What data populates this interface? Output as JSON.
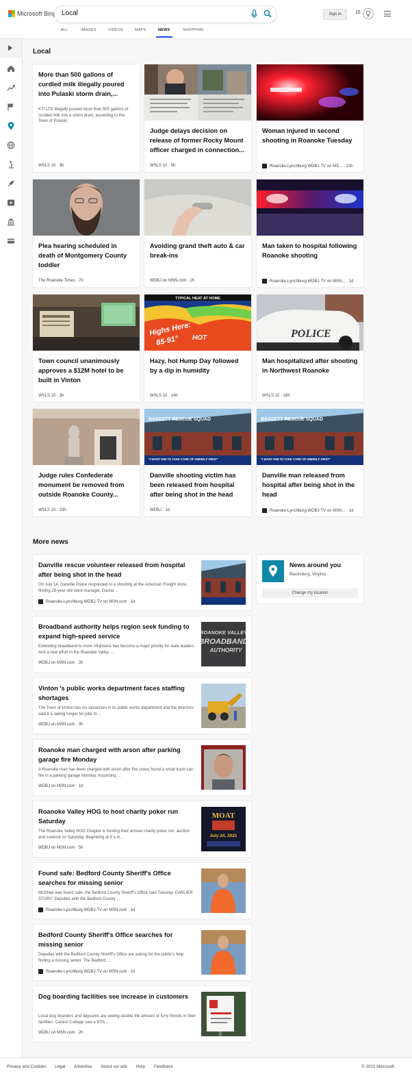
{
  "brand": {
    "name": "Microsoft Bing"
  },
  "search": {
    "query": "Local"
  },
  "header": {
    "sign_in": "Sign in",
    "points": "15"
  },
  "scopes": [
    "ALL",
    "IMAGES",
    "VIDEOS",
    "MAPS",
    "NEWS",
    "SHOPPING"
  ],
  "active_scope": "NEWS",
  "local": {
    "heading": "Local",
    "cards": [
      {
        "title": "More than 500 gallons of curdled milk illegally poured into Pulaski storm drain,...",
        "snippet": "KTI LTD illegally poured more than 500 gallons of curdled milk into a storm drain, according to the Town of Pulaski.",
        "source": "WSLS 10",
        "time": "3h",
        "image": "none"
      },
      {
        "title": "Judge delays decision on release of former Rocky Mount officer charged in connection...",
        "source": "WSLS 10",
        "time": "5h",
        "image": "collage"
      },
      {
        "title": "Woman injured in second shooting in Roanoke Tuesday",
        "source": "Roanoke-Lynchburg WDBJ-TV on MS...",
        "time": "12h",
        "image": "police-lights"
      },
      {
        "title": "Plea hearing scheduled in death of Montgomery County toddler",
        "source": "The Roanoke Times",
        "time": "7h",
        "image": "mugshot"
      },
      {
        "title": "Avoiding grand theft auto & car break-ins",
        "source": "WDBJ on MSN.com",
        "time": "2h",
        "image": "car-door"
      },
      {
        "title": "Man taken to hospital following Roanoke shooting",
        "source": "Roanoke-Lynchburg WDBJ-TV on MSN...",
        "time": "1d",
        "image": "police-lights-2"
      },
      {
        "title": "Town council unanimously approves a $12M hotel to be built in Vinton",
        "source": "WSLS 10",
        "time": "3h",
        "image": "council"
      },
      {
        "title": "Hazy, hot Hump Day followed by a dip in humidity",
        "source": "WSLS 10",
        "time": "14h",
        "image": "weather-map"
      },
      {
        "title": "Man hospitalized after shooting in Northwest Roanoke",
        "source": "WSLS 10",
        "time": "19h",
        "image": "police-car"
      },
      {
        "title": "Judge rules Confederate monument be removed from outside Roanoke County...",
        "source": "WSLS 10",
        "time": "23h",
        "image": "monument"
      },
      {
        "title": "Danville shooting victim has been released from hospital after being shot in the head",
        "source": "WDBJ",
        "time": "1d",
        "image": "rescue-squad"
      },
      {
        "title": "Danville man released from hospital after being shot in the head",
        "source": "Roanoke-Lynchburg WDBJ-TV on MSN...",
        "time": "1d",
        "image": "rescue-squad"
      }
    ]
  },
  "weather_map": {
    "banner": "TYPICAL HEAT AT HOME",
    "line1": "Highs Here:",
    "line2": "85-91°",
    "hot": "HOT"
  },
  "police_car_text": "POLICE",
  "rescue_text": "BASSETT RESCUE SQUAD",
  "chyron": "\"I WANT HIM TO TAKE CARE OF HIMSELF FIRST\"",
  "broadband_logo": [
    "ROANOKE VALLEY",
    "BROADBAND",
    "AUTHORITY"
  ],
  "poker_flyer": [
    "MOAT",
    "July 24, 2021"
  ],
  "more_news": {
    "heading": "More news",
    "items": [
      {
        "title": "Danville rescue volunteer released from hospital after being shot in the head",
        "snippet": "On July 14, Danville Police responded to a shooting at the American Freight store, finding 29-year-old store manager, Dacha ...",
        "source": "Roanoke-Lynchburg WDBJ-TV on MSN.com",
        "time": "1d",
        "logo": true,
        "thumb": "rescue-squad"
      },
      {
        "title": "Broadband authority helps region seek funding to expand high-speed service",
        "snippet": "Extending broadband to more Virginians has become a major priority for state leaders. And a new effort in the Roanoke Valley ...",
        "source": "WDBJ on MSN.com",
        "time": "2h",
        "logo": false,
        "thumb": "broadband"
      },
      {
        "title": "Vinton 's public works department faces staffing shortages",
        "snippet": "The Town of Vinton has six vacancies in its public works department and the directors said it is taking longer for jobs to ...",
        "source": "WDBJ on MSN.com",
        "time": "3h",
        "logo": false,
        "thumb": "excavator"
      },
      {
        "title": "Roanoke man charged with arson after parking garage fire Monday",
        "snippet": "A Roanoke man has been charged with arson after fire crews found a small trash can fire in a parking garage Monday. According ...",
        "source": "WDBJ on MSN.com",
        "time": "1d",
        "logo": false,
        "thumb": "mugshot2"
      },
      {
        "title": "Roanoke Valley HOG to host charity poker run Saturday",
        "snippet": "The Roanoke Valley HOG Chapter is hosting their annual charity poker run, auction and cookout on Saturday. Beginning at 9 a.m ...",
        "source": "WDBJ on MSN.com",
        "time": "5h",
        "logo": false,
        "thumb": "poker"
      },
      {
        "title": "Found safe: Bedford County Sheriff's Office searches for missing senior",
        "snippet": "McGhee was found safe, the Bedford County Sheriff's Office said Tuesday. EARLIER STORY: Deputies with the Bedford County ...",
        "source": "Roanoke-Lynchburg WDBJ-TV on MSN.com",
        "time": "1d",
        "logo": true,
        "thumb": "senior"
      },
      {
        "title": "Bedford County Sheriff's Office searches for missing senior",
        "snippet": "Deputies with the Bedford County Sheriff's Office are asking for the public's help finding a missing senior. The Bedford ...",
        "source": "Roanoke-Lynchburg WDBJ-TV on MSN.com",
        "time": "1d",
        "logo": true,
        "thumb": "senior"
      },
      {
        "title": "Dog boarding facilities see increase in customers",
        "snippet": "Local dog boarders and daycares are seeing double the amount of furry friends in their facilities. Canine Cottage saw a 97% ...",
        "source": "WDBJ on MSN.com",
        "time": "2h",
        "logo": false,
        "thumb": "dog-sign"
      }
    ]
  },
  "news_around": {
    "title": "News around you",
    "location": "Blacksburg, Virginia",
    "button": "Change my location"
  },
  "footer": {
    "links": [
      "Privacy and Cookies",
      "Legal",
      "Advertise",
      "About our ads",
      "Help",
      "Feedback"
    ],
    "copyright": "© 2021 Microsoft"
  }
}
